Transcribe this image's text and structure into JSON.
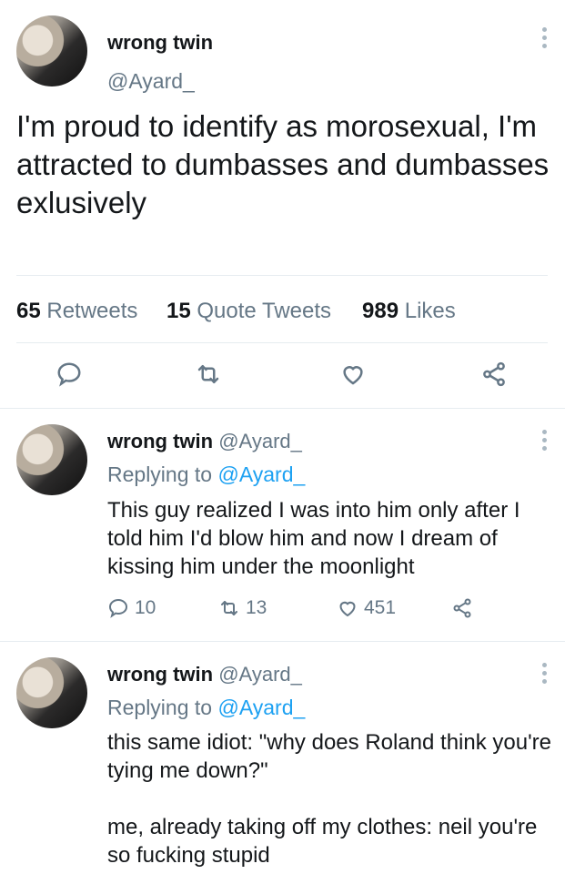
{
  "main_tweet": {
    "display_name": "wrong twin",
    "handle": "@Ayard_",
    "text": "I'm proud to identify as morosexual, I'm attracted to dumbasses and dumbasses exlusively",
    "stats": {
      "retweets_count": "65",
      "retweets_label": "Retweets",
      "quotes_count": "15",
      "quotes_label": "Quote Tweets",
      "likes_count": "989",
      "likes_label": "Likes"
    },
    "icons": [
      "reply-icon",
      "retweet-icon",
      "like-icon",
      "share-icon"
    ]
  },
  "replies": [
    {
      "display_name": "wrong twin",
      "handle": "@Ayard_",
      "replying_prefix": "Replying to",
      "replying_to": "@Ayard_",
      "text": "This guy realized I was into him only after I told him I'd blow him and now I dream of kissing him under the moonlight",
      "reply_count": "10",
      "retweet_count": "13",
      "like_count": "451"
    },
    {
      "display_name": "wrong twin",
      "handle": "@Ayard_",
      "replying_prefix": "Replying to",
      "replying_to": "@Ayard_",
      "text": "this same idiot: \"why does Roland think you're tying me down?\"\n\nme, already taking off my clothes: neil you're so fucking stupid"
    }
  ],
  "colors": {
    "link": "#1da1f2",
    "muted": "#657786",
    "text": "#14171a",
    "divider": "#e6ecf0"
  }
}
